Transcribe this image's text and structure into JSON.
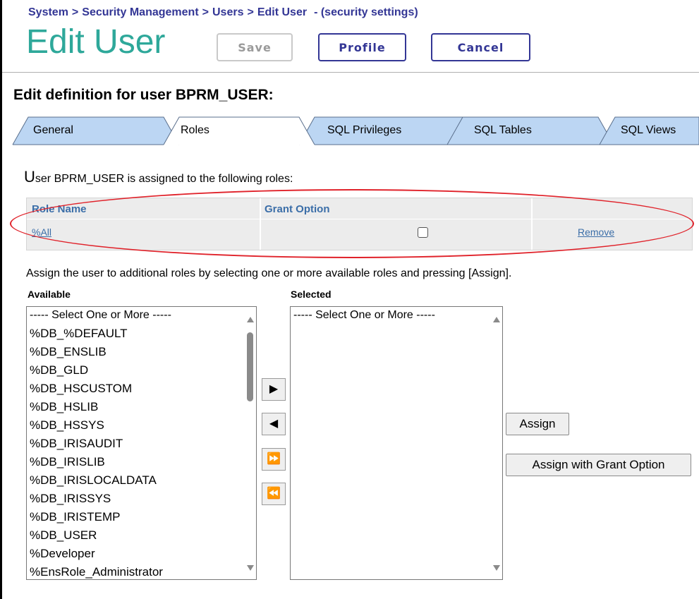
{
  "breadcrumb": {
    "items": [
      "System",
      "Security Management",
      "Users",
      "Edit User"
    ],
    "suffix": "- (security settings)",
    "separator": ">"
  },
  "page_title": "Edit User",
  "header_buttons": {
    "save": "Save",
    "profile": "Profile",
    "cancel": "Cancel"
  },
  "section_title": "Edit definition for user BPRM_USER:",
  "tabs": [
    {
      "label": "General",
      "active": false
    },
    {
      "label": "Roles",
      "active": true
    },
    {
      "label": "SQL Privileges",
      "active": false
    },
    {
      "label": "SQL Tables",
      "active": false
    },
    {
      "label": "SQL Views",
      "active": false
    }
  ],
  "assigned_text": {
    "first_letter": "U",
    "rest": "ser BPRM_USER is assigned to the following roles:"
  },
  "roles_table": {
    "headers": {
      "role_name": "Role Name",
      "grant_option": "Grant Option"
    },
    "rows": [
      {
        "role_name": "%All",
        "grant_option": false,
        "action": "Remove"
      }
    ]
  },
  "instructions": "Assign the user to additional roles by selecting one or more available roles and pressing [Assign].",
  "available": {
    "label": "Available",
    "items": [
      "----- Select One or More -----",
      "%DB_%DEFAULT",
      "%DB_ENSLIB",
      "%DB_GLD",
      "%DB_HSCUSTOM",
      "%DB_HSLIB",
      "%DB_HSSYS",
      "%DB_IRISAUDIT",
      "%DB_IRISLIB",
      "%DB_IRISLOCALDATA",
      "%DB_IRISSYS",
      "%DB_IRISTEMP",
      "%DB_USER",
      "%Developer",
      "%EnsRole_Administrator"
    ]
  },
  "selected": {
    "label": "Selected",
    "items": [
      "----- Select One or More -----"
    ]
  },
  "transfer_buttons": {
    "move_right": "▶",
    "move_left": "◀",
    "move_all_right": "⏩",
    "move_all_left": "⏪"
  },
  "assign_buttons": {
    "assign": "Assign",
    "assign_grant": "Assign with Grant Option"
  },
  "colors": {
    "title": "#2ea89a",
    "brand": "#333695",
    "link": "#3b6ea8",
    "tab": "#bcd6f3",
    "highlight": "#e0222a"
  }
}
